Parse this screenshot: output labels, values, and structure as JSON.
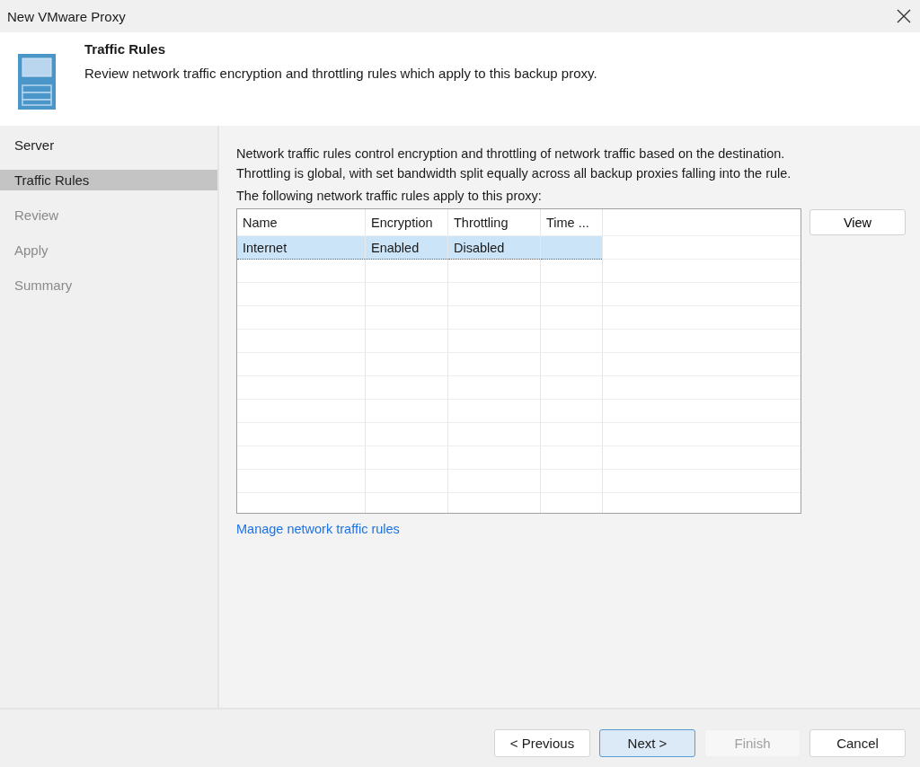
{
  "window": {
    "title": "New VMware Proxy"
  },
  "header": {
    "title": "Traffic Rules",
    "description": "Review network traffic encryption and throttling rules which apply to this backup proxy."
  },
  "steps": [
    {
      "label": "Server",
      "selected": false,
      "disabled": false
    },
    {
      "label": "Traffic Rules",
      "selected": true,
      "disabled": false
    },
    {
      "label": "Review",
      "selected": false,
      "disabled": true
    },
    {
      "label": "Apply",
      "selected": false,
      "disabled": true
    },
    {
      "label": "Summary",
      "selected": false,
      "disabled": true
    }
  ],
  "content": {
    "lines": [
      "Network traffic rules control encryption and throttling of network traffic based on the destination.",
      "Throttling is global, with set bandwidth split equally across all backup proxies falling into the rule."
    ],
    "caption": "The following network traffic rules apply to this proxy:",
    "view_button": "View",
    "link": "Manage network traffic rules"
  },
  "table": {
    "columns": [
      "Name",
      "Encryption",
      "Throttling",
      "Time ..."
    ],
    "rows": [
      {
        "cells": [
          "Internet",
          "Enabled",
          "Disabled",
          ""
        ],
        "selected": true
      }
    ]
  },
  "buttons": [
    {
      "label": "< Previous",
      "default": false,
      "disabled": false
    },
    {
      "label": "Next >",
      "default": true,
      "disabled": false
    },
    {
      "label": "Finish",
      "default": false,
      "disabled": true
    },
    {
      "label": "Cancel",
      "default": false,
      "disabled": false
    }
  ]
}
